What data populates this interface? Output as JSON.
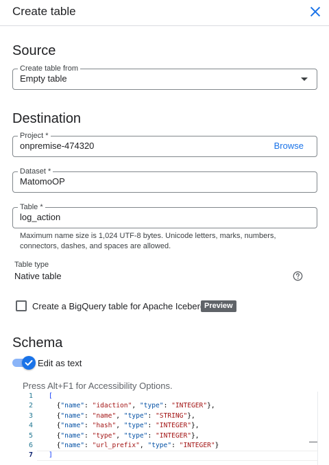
{
  "header": {
    "title": "Create table",
    "close_icon": "close-icon"
  },
  "source": {
    "title": "Source",
    "create_from": {
      "label": "Create table from",
      "value": "Empty table"
    }
  },
  "destination": {
    "title": "Destination",
    "project": {
      "label": "Project *",
      "value": "onpremise-474320",
      "browse": "Browse"
    },
    "dataset": {
      "label": "Dataset *",
      "value": "MatomoOP"
    },
    "table": {
      "label": "Table *",
      "value": "log_action",
      "hint": "Maximum name size is 1,024 UTF-8 bytes. Unicode letters, marks, numbers, connectors, dashes, and spaces are allowed."
    },
    "table_type": {
      "label": "Table type",
      "value": "Native table",
      "help_icon": "help-icon"
    },
    "iceberg": {
      "label": "Create a BigQuery table for Apache Iceberg",
      "badge": "Preview",
      "checked": false
    }
  },
  "schema": {
    "title": "Schema",
    "edit_as_text": {
      "label": "Edit as text",
      "enabled": true
    },
    "accessibility_hint": "Press Alt+F1 for Accessibility Options.",
    "editor": {
      "line_numbers": [
        "1",
        "2",
        "3",
        "4",
        "5",
        "6",
        "7"
      ],
      "current_line": 7,
      "open_bracket": "[",
      "close_bracket": "]",
      "fields": [
        {
          "name": "idaction",
          "type": "INTEGER"
        },
        {
          "name": "name",
          "type": "STRING"
        },
        {
          "name": "hash",
          "type": "INTEGER"
        },
        {
          "name": "type",
          "type": "INTEGER"
        },
        {
          "name": "url_prefix",
          "type": "INTEGER"
        }
      ],
      "lines": [
        "[",
        "  {\"name\": \"idaction\", \"type\": \"INTEGER\"},",
        "  {\"name\": \"name\", \"type\": \"STRING\"},",
        "  {\"name\": \"hash\", \"type\": \"INTEGER\"},",
        "  {\"name\": \"type\", \"type\": \"INTEGER\"},",
        "  {\"name\": \"url_prefix\", \"type\": \"INTEGER\"}",
        "]"
      ]
    }
  },
  "colors": {
    "accent": "#1a73e8",
    "text": "#202124",
    "secondary_text": "#5f6368",
    "badge_bg": "#5f6368",
    "json_key": "#0451a5",
    "json_string": "#a31515"
  }
}
